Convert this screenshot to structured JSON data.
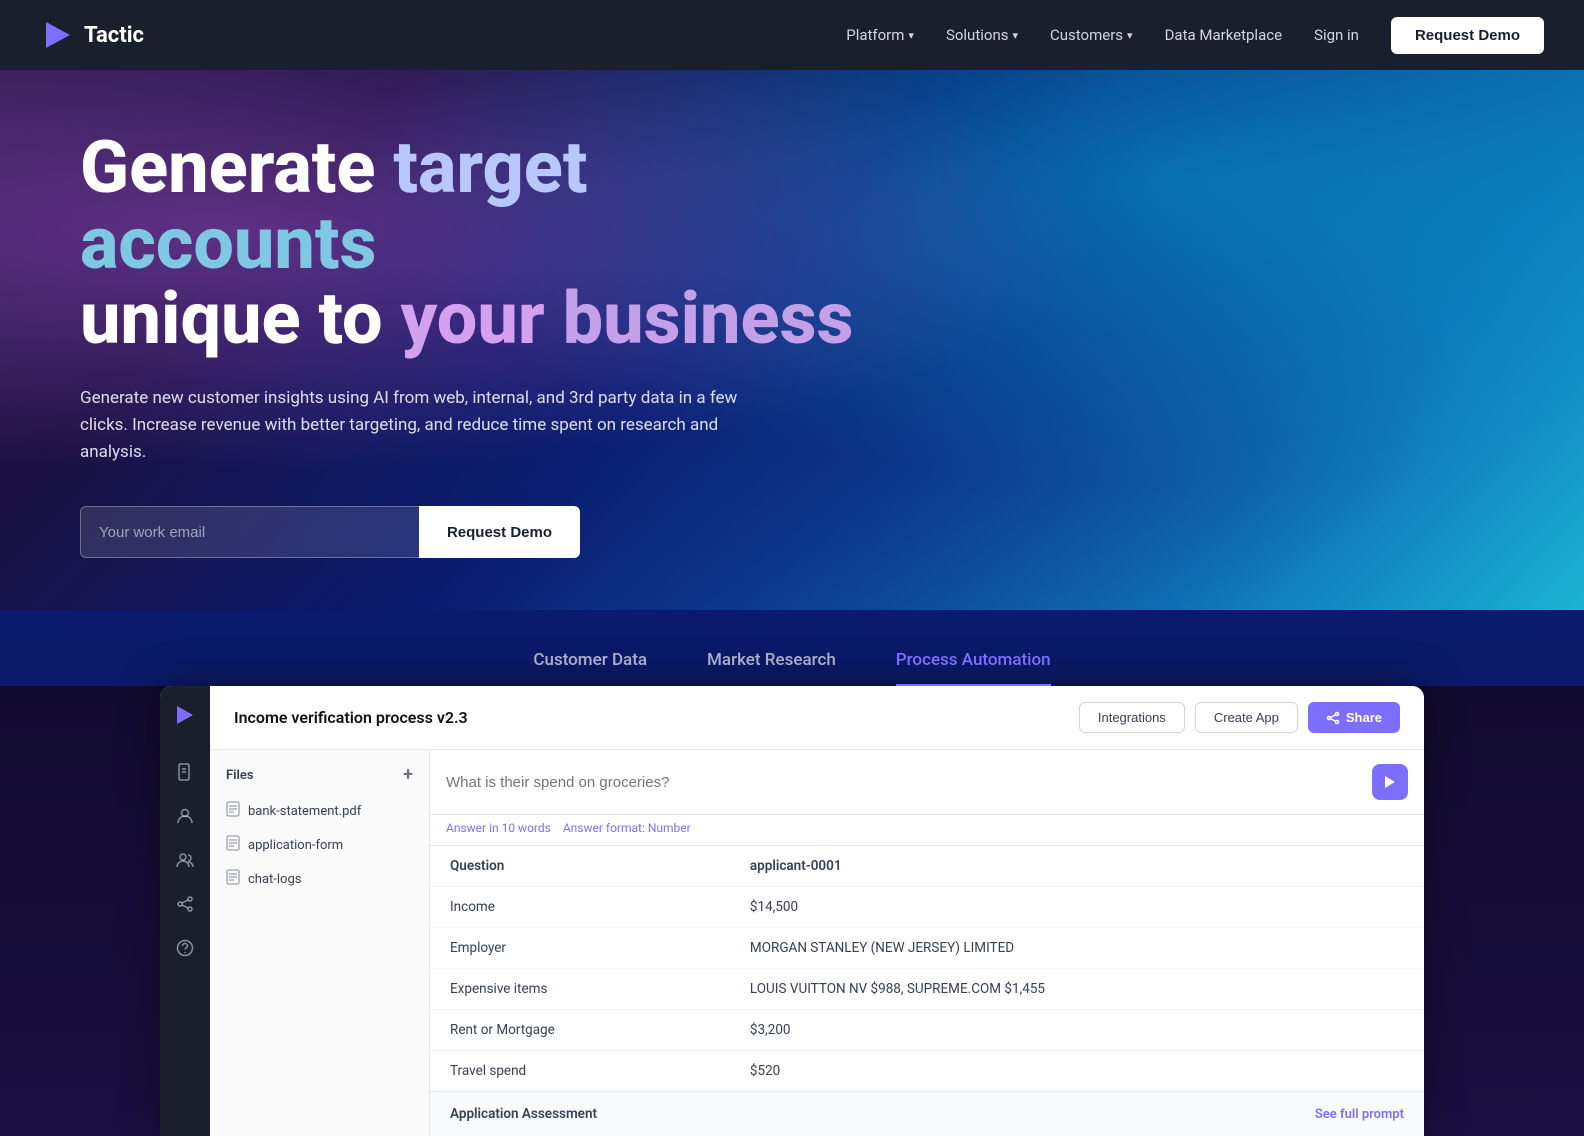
{
  "nav": {
    "logo_text": "Tactic",
    "links": [
      {
        "id": "platform",
        "label": "Platform",
        "has_chevron": true
      },
      {
        "id": "solutions",
        "label": "Solutions",
        "has_chevron": true
      },
      {
        "id": "customers",
        "label": "Customers",
        "has_chevron": true
      },
      {
        "id": "data-marketplace",
        "label": "Data Marketplace",
        "has_chevron": false
      }
    ],
    "signin_label": "Sign in",
    "demo_label": "Request Demo"
  },
  "hero": {
    "title_line1_part1": "Generate ",
    "title_line1_target": "target",
    "title_line1_part2": " ",
    "title_line1_accounts": "accounts",
    "title_line2_part1": "unique to ",
    "title_line2_your": "your",
    "title_line2_part2": " ",
    "title_line2_business": "business",
    "subtitle": "Generate new customer insights using AI from web, internal, and 3rd party data in a few clicks. Increase revenue with better targeting, and reduce time spent on research and analysis.",
    "email_placeholder": "Your work email",
    "cta_label": "Request Demo"
  },
  "tabs": [
    {
      "id": "customer-data",
      "label": "Customer Data",
      "active": false
    },
    {
      "id": "market-research",
      "label": "Market Research",
      "active": false
    },
    {
      "id": "process-automation",
      "label": "Process Automation",
      "active": true
    }
  ],
  "panel": {
    "title": "Income verification process v2.3",
    "integrations_label": "Integrations",
    "create_app_label": "Create App",
    "share_label": "Share",
    "files_header": "Files",
    "files_add": "+",
    "files": [
      {
        "name": "bank-statement.pdf"
      },
      {
        "name": "application-form"
      },
      {
        "name": "chat-logs"
      }
    ],
    "query_placeholder": "What is their spend on groceries?",
    "hint1": "Answer in 10 words",
    "hint2": "Answer format: Number",
    "table": {
      "col1": "Question",
      "col2": "applicant-0001",
      "rows": [
        {
          "label": "Income",
          "value": "$14,500"
        },
        {
          "label": "Employer",
          "value": "MORGAN STANLEY (NEW JERSEY) LIMITED"
        },
        {
          "label": "Expensive items",
          "value": "LOUIS VUITTON NV $988, SUPREME.COM $1,455"
        },
        {
          "label": "Rent or Mortgage",
          "value": "$3,200"
        },
        {
          "label": "Travel spend",
          "value": "$520"
        }
      ]
    },
    "assessment_label": "Application Assessment",
    "see_prompt_label": "See full prompt"
  },
  "colors": {
    "accent": "#7c6fff",
    "nav_bg": "#1a1f2e"
  }
}
